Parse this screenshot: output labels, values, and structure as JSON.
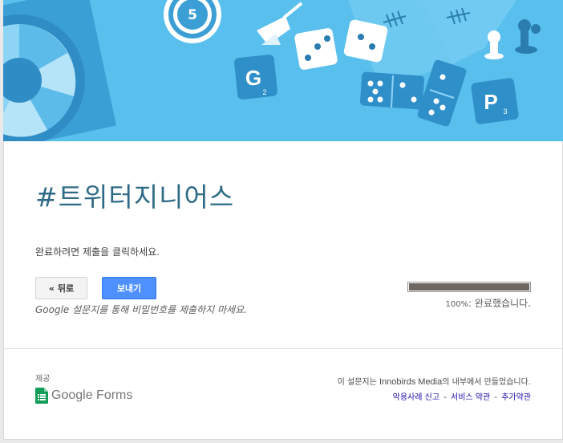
{
  "form": {
    "title": "#트위터지니어스",
    "instruction": "완료하려면 제출을 클릭하세요.",
    "warning": "Google 설문지를 통해 비밀번호를 제출하지 마세요."
  },
  "buttons": {
    "back_label": "« 뒤로",
    "submit_label": "보내기"
  },
  "progress": {
    "fraction": 1.0,
    "percent_text": "100%",
    "status_text": ": 완료했습니다."
  },
  "banner": {
    "chip_number": "5",
    "tile_g_letter": "G",
    "tile_g_score": "2",
    "tile_p_letter": "P",
    "tile_p_score": "3"
  },
  "footer": {
    "powered_by": "제공",
    "logo_text": "Google Forms",
    "made_by_prefix": "이 설문지는 ",
    "made_by_org": "Innobirds Media",
    "made_by_suffix": "의 내부에서 만들었습니다.",
    "links": [
      "악용사례 신고",
      "서비스 약관",
      "추가약관"
    ],
    "separator": "-"
  },
  "colors": {
    "banner_bg": "#59c0ee",
    "title": "#2f6b86",
    "submit_button": "#4d90fe",
    "progress_fill": "#6e6761",
    "link": "#1a0dab",
    "forms_green": "#0f9d58"
  }
}
